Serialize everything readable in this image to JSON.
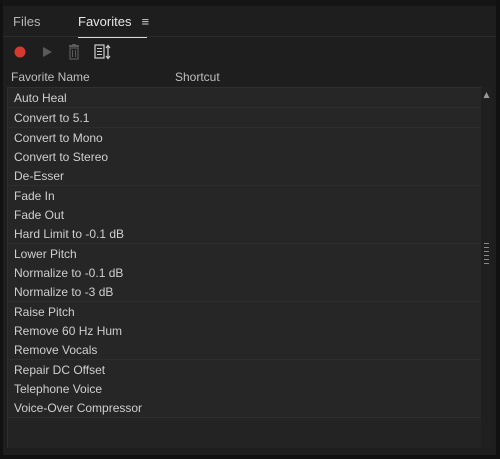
{
  "tabs": [
    {
      "label": "Files",
      "active": false
    },
    {
      "label": "Favorites",
      "active": true,
      "menu_icon": "≡"
    }
  ],
  "toolbar": {
    "buttons": [
      {
        "name": "record-icon",
        "color": "#d9382f"
      },
      {
        "name": "play-icon"
      },
      {
        "name": "trash-icon"
      },
      {
        "name": "sort-icon"
      }
    ]
  },
  "columns": {
    "name": "Favorite Name",
    "shortcut": "Shortcut"
  },
  "favorites": [
    "Auto Heal",
    "Convert to 5.1",
    "Convert to Mono",
    "Convert to Stereo",
    "De-Esser",
    "Fade In",
    "Fade Out",
    "Hard Limit to -0.1 dB",
    "Lower Pitch",
    "Normalize to -0.1 dB",
    "Normalize to -3 dB",
    "Raise Pitch",
    "Remove 60 Hz Hum",
    "Remove Vocals",
    "Repair DC Offset",
    "Telephone Voice",
    "Voice-Over Compressor"
  ]
}
